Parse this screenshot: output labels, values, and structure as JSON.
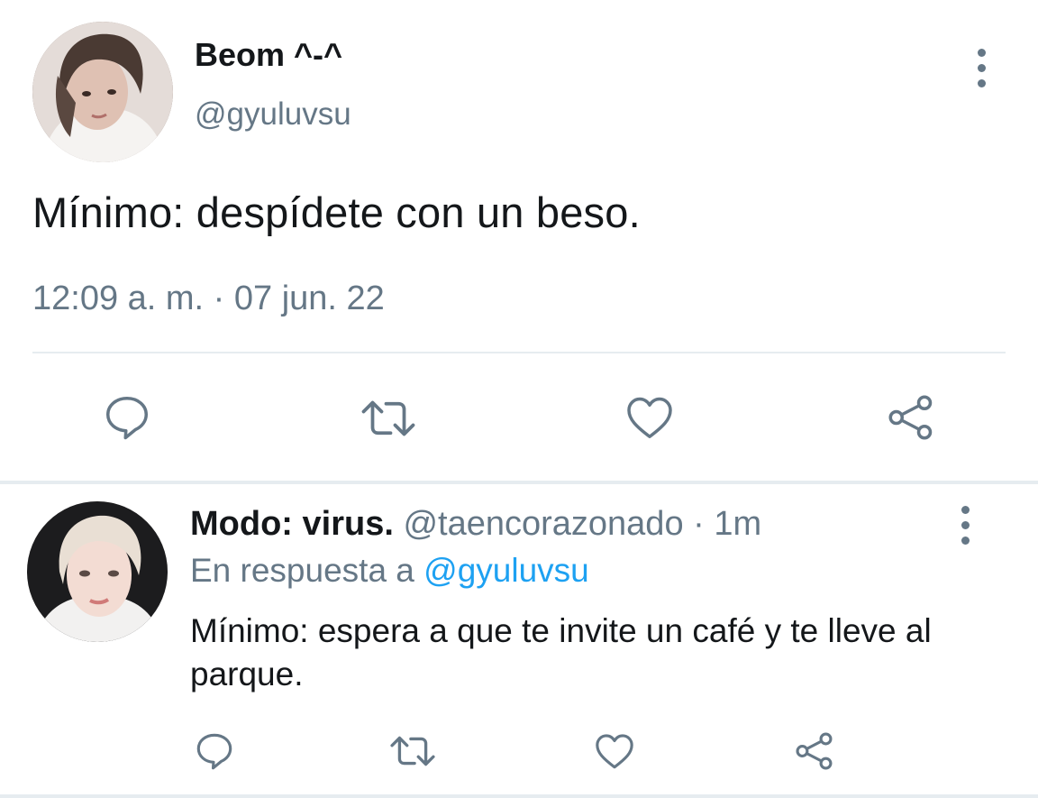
{
  "main_tweet": {
    "display_name": "Beom ^-^",
    "handle": "@gyuluvsu",
    "text": "Mínimo: despídete con un beso.",
    "timestamp": "12:09 a. m. · 07 jun. 22",
    "avatar_icon": "user-avatar-photo",
    "more_icon": "more-vertical-icon",
    "actions": [
      "reply-icon",
      "retweet-icon",
      "like-icon",
      "share-icon"
    ]
  },
  "reply_tweet": {
    "display_name": "Modo: virus.",
    "handle_meta": " @taencorazonado · 1m",
    "reply_to_prefix": "En respuesta a ",
    "reply_to_handle": "@gyuluvsu",
    "text": "Mínimo: espera a que te invite un café y te lleve al parque.",
    "avatar_icon": "user-avatar-photo",
    "more_icon": "more-vertical-icon",
    "actions": [
      "reply-icon",
      "retweet-icon",
      "like-icon",
      "share-icon"
    ]
  },
  "colors": {
    "text_primary": "#14171a",
    "text_secondary": "#657786",
    "link": "#1da1f2",
    "divider": "#e6ecf0",
    "icon": "#657786"
  }
}
